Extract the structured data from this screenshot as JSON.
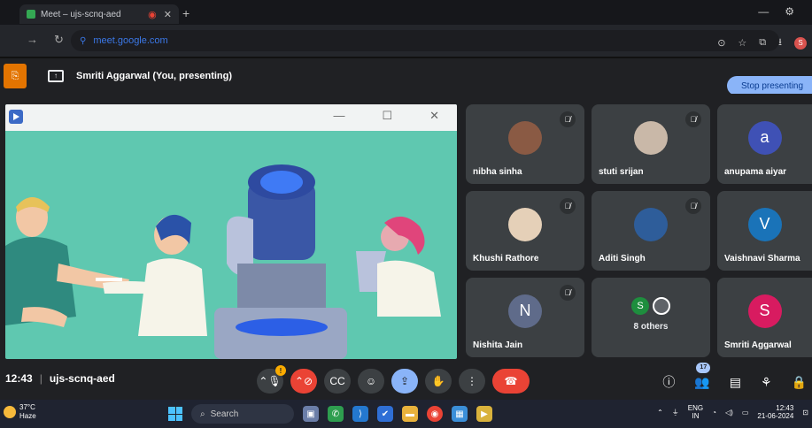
{
  "browser": {
    "tab_title": "Meet – ujs-scnq-aed",
    "url": "meet.google.com",
    "profile_initial": "S"
  },
  "presenting": {
    "text": "Smriti Aggarwal (You, presenting)",
    "stop_label": "Stop presenting"
  },
  "participants": [
    {
      "name": "nibha sinha",
      "avatar": "photo",
      "muted": true
    },
    {
      "name": "stuti srijan",
      "avatar": "photo",
      "muted": true
    },
    {
      "name": "anupama aiyar",
      "avatar": "a",
      "color": "#3f51b5",
      "muted": true
    },
    {
      "name": "Khushi Rathore",
      "avatar": "photo",
      "muted": true
    },
    {
      "name": "Aditi Singh",
      "avatar": "photo",
      "muted": true
    },
    {
      "name": "Vaishnavi Sharma",
      "avatar": "V",
      "color": "#1a73b8",
      "muted": true
    },
    {
      "name": "Nishita Jain",
      "avatar": "N",
      "color": "#5f6b8a",
      "muted": true
    },
    {
      "name": "8 others",
      "avatar": "S",
      "color": "#1e8e3e"
    },
    {
      "name": "Smriti Aggarwal",
      "avatar": "S",
      "color": "#d81b60"
    }
  ],
  "meeting": {
    "time": "12:43",
    "code": "ujs-scnq-aed",
    "people_count": "17"
  },
  "taskbar": {
    "temp": "37°C",
    "weather": "Haze",
    "search_label": "Search",
    "lang1": "ENG",
    "lang2": "IN",
    "time": "12:43",
    "date": "21-06-2024"
  }
}
